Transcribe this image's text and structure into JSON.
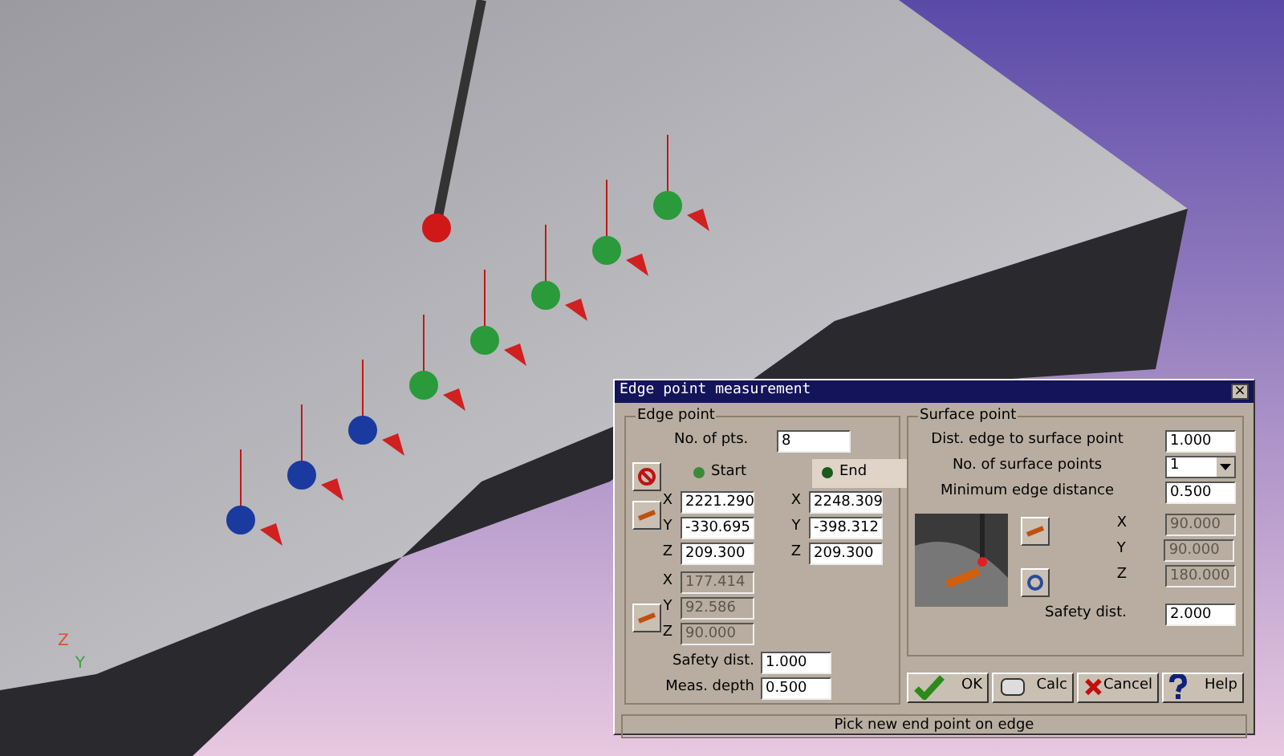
{
  "viewport": {
    "axis_labels": [
      "Z",
      "Y"
    ]
  },
  "dialog": {
    "title": "Edge point measurement",
    "close": "×",
    "edge_point": {
      "title": "Edge point",
      "no_of_pts": {
        "label": "No. of pts.",
        "value": "8"
      },
      "points": [
        {
          "label": "Start",
          "selected": false,
          "coords": [
            {
              "axis": "X",
              "value": "2221.290"
            },
            {
              "axis": "Y",
              "value": "-330.695"
            },
            {
              "axis": "Z",
              "value": "209.300"
            }
          ]
        },
        {
          "label": "End",
          "selected": true,
          "coords": [
            {
              "axis": "X",
              "value": "2248.309"
            },
            {
              "axis": "Y",
              "value": "-398.312"
            },
            {
              "axis": "Z",
              "value": "209.300"
            }
          ]
        }
      ],
      "direction": [
        {
          "axis": "X",
          "value": "177.414",
          "disabled": true
        },
        {
          "axis": "Y",
          "value": "92.586",
          "disabled": true
        },
        {
          "axis": "Z",
          "value": "90.000",
          "disabled": true
        }
      ],
      "fields": [
        {
          "label": "Safety dist.",
          "value": "1.000"
        },
        {
          "label": "Meas. depth",
          "value": "0.500"
        }
      ]
    },
    "surface_point": {
      "title": "Surface point",
      "fields": [
        {
          "kind": "input",
          "label": "Dist. edge to surface point",
          "value": "1.000"
        },
        {
          "kind": "select",
          "label": "No. of surface points",
          "value": "1"
        },
        {
          "kind": "input",
          "label": "Minimum edge distance",
          "value": "0.500"
        }
      ],
      "direction": [
        {
          "axis": "X",
          "value": "90.000",
          "disabled": true
        },
        {
          "axis": "Y",
          "value": "90.000",
          "disabled": true
        },
        {
          "axis": "Z",
          "value": "180.000",
          "disabled": true
        }
      ],
      "safety": {
        "label": "Safety dist.",
        "value": "2.000"
      }
    },
    "buttons": [
      {
        "kind": "ok",
        "label": "OK"
      },
      {
        "kind": "calc",
        "label": "Calc"
      },
      {
        "kind": "cancel",
        "label": "Cancel"
      },
      {
        "kind": "help",
        "label": "Help"
      }
    ],
    "status": "Pick new end point on edge"
  }
}
